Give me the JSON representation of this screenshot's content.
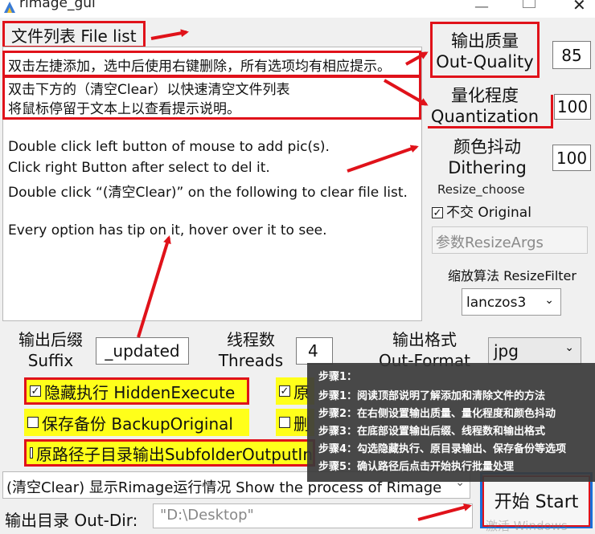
{
  "window": {
    "title": "rimage_gui"
  },
  "file_list": {
    "header_label": "文件列表 File list",
    "lines": [
      "双击左捷添加，选中后使用右键删除，所有选项均有相应提示。",
      "双击下方的（清空Clear）以快速清空文件列表",
      "将鼠标停留于文本上以查看提示说明。",
      "Double click left button of mouse to add pic(s).",
      "Click right Button after select to del it.",
      "Double click “(清空Clear)” on the following to clear file list.",
      "Every option has tip on it, hover over it to see."
    ]
  },
  "quality": {
    "label_cn": "输出质量",
    "label_en": "Out-Quality",
    "value": "85"
  },
  "quantization": {
    "label_cn": "量化程度",
    "label_en": "Quantization",
    "value": "100"
  },
  "dithering": {
    "label_cn": "颜色抖动",
    "label_en": "Dithering",
    "value": "100"
  },
  "resize": {
    "choose_label": "Resize_choose",
    "original_label": "不交 Original",
    "original_checked": true,
    "args_placeholder": "参数ResizeArgs",
    "filter_label": "缩放算法 ResizeFilter",
    "filter_value": "lanczos3"
  },
  "suffix": {
    "label_cn": "输出后缀",
    "label_en": "Suffix",
    "value": "_updated"
  },
  "threads": {
    "label_cn": "线程数",
    "label_en": "Threads",
    "value": "4"
  },
  "out_format": {
    "label_cn": "输出格式",
    "label_en": "Out-Format",
    "value": "jpg"
  },
  "options": {
    "hidden_execute": "隐藏执行 HiddenExecute",
    "hidden_execute_checked": true,
    "original_dir_partial": "原",
    "original_dir_checked": true,
    "backup_original": "保存备份 BackupOriginal",
    "backup_checked": false,
    "delete_partial": "删",
    "delete_checked": false,
    "subfolder_output": "原路径子目录输出SubfolderOutputIn",
    "subfolder_checked": false
  },
  "status_bar": {
    "text": "(清空Clear) 显示Rimage运行情况 Show the process of Rimage"
  },
  "out_dir": {
    "label": "输出目录 Out-Dir:",
    "value": "\"D:\\Desktop\""
  },
  "start_button": {
    "label": "开始 Start"
  },
  "tooltip": {
    "lines": [
      "步骤1：",
      "步骤1：阅读顶部说明了解添加和清除文件的方法",
      "步骤2：在右侧设置输出质量、量化程度和颜色抖动",
      "步骤3：在底部设置输出后缀、线程数和输出格式",
      "步骤4：勾选隐藏执行、原目录输出、保存备份等选项",
      "步骤5：确认路径后点击开始执行批量处理"
    ]
  },
  "watermark": "激活 Windows",
  "colors": {
    "annotation_red": "#e0121a",
    "highlight_yellow": "#ffff1a",
    "start_border": "#1a6ed8"
  }
}
